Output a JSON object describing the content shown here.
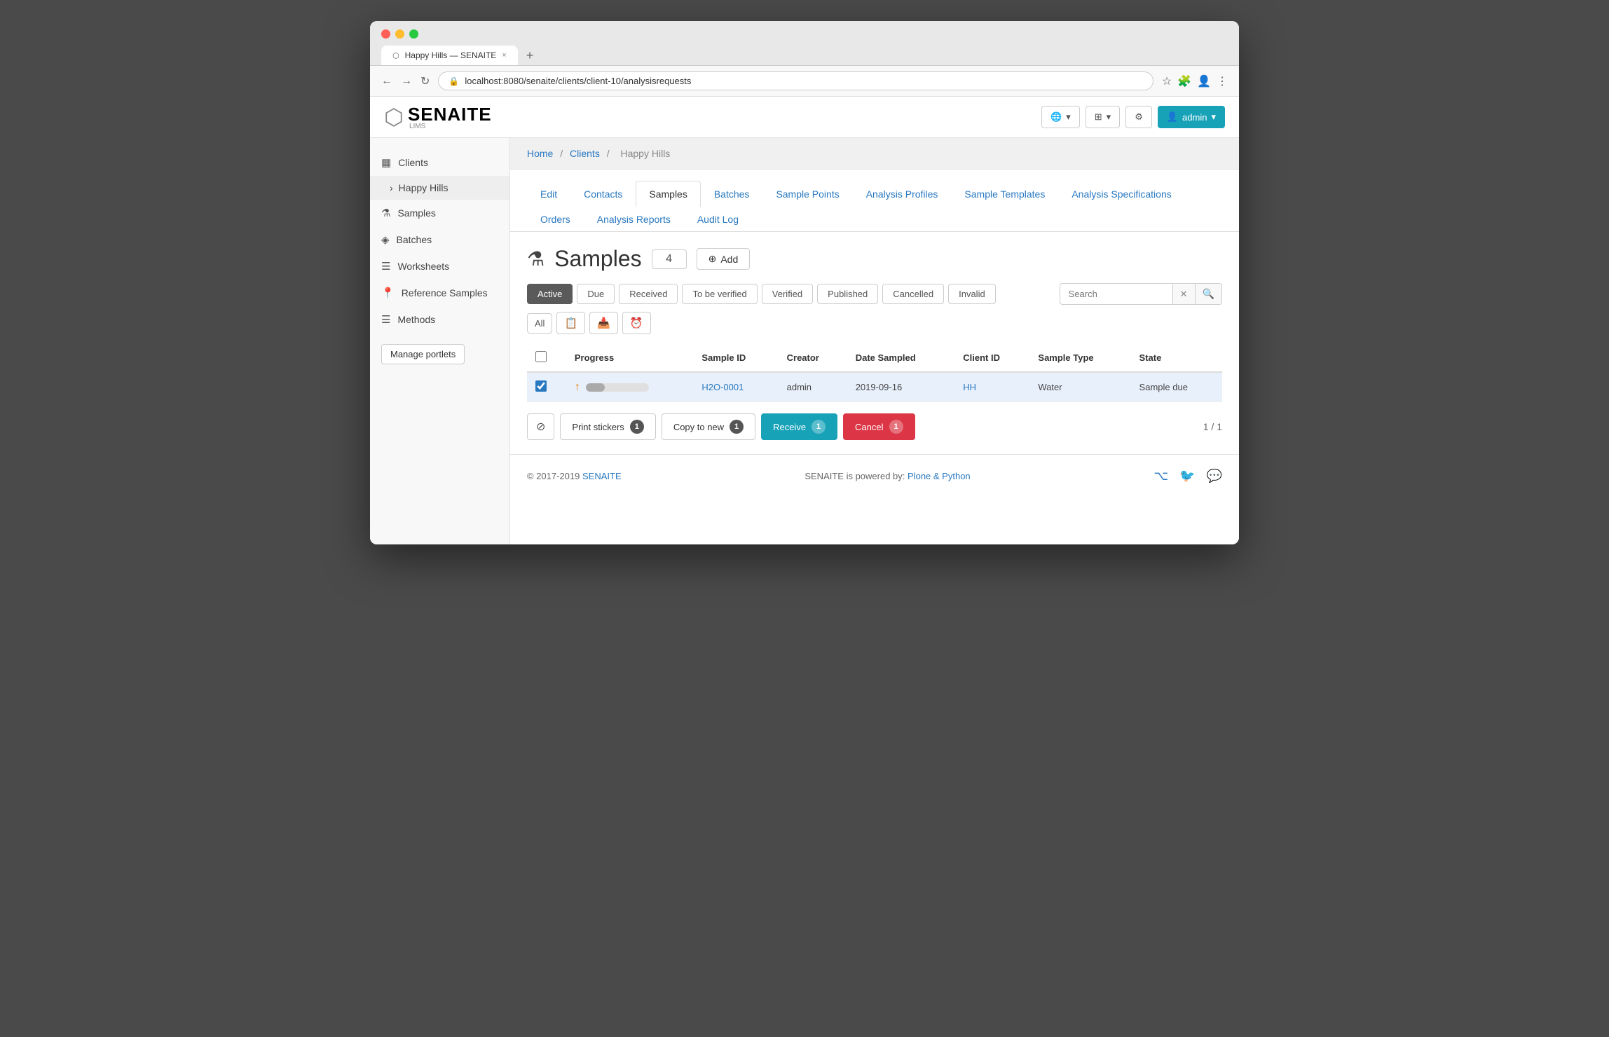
{
  "browser": {
    "tab_title": "Happy Hills — SENAITE",
    "url": "localhost:8080/senaite/clients/client-10/analysisrequests",
    "tab_close": "×",
    "tab_add": "+"
  },
  "topnav": {
    "logo_text": "SENAITE",
    "logo_sub": "LIMS",
    "globe_btn": "🌐",
    "grid_btn": "⊞",
    "gear_btn": "⚙",
    "admin_btn": "admin"
  },
  "sidebar": {
    "items": [
      {
        "id": "clients",
        "icon": "▦",
        "label": "Clients"
      },
      {
        "id": "happy-hills",
        "icon": "›",
        "label": "Happy Hills"
      },
      {
        "id": "samples",
        "icon": "⚗",
        "label": "Samples"
      },
      {
        "id": "batches",
        "icon": "◈",
        "label": "Batches"
      },
      {
        "id": "worksheets",
        "icon": "☰",
        "label": "Worksheets"
      },
      {
        "id": "reference-samples",
        "icon": "📍",
        "label": "Reference Samples"
      },
      {
        "id": "methods",
        "icon": "☰",
        "label": "Methods"
      }
    ],
    "manage_portlets": "Manage portlets"
  },
  "breadcrumb": {
    "home": "Home",
    "clients": "Clients",
    "current": "Happy Hills"
  },
  "tabs": {
    "items": [
      {
        "id": "edit",
        "label": "Edit"
      },
      {
        "id": "contacts",
        "label": "Contacts"
      },
      {
        "id": "samples",
        "label": "Samples",
        "active": true
      },
      {
        "id": "batches",
        "label": "Batches"
      },
      {
        "id": "sample-points",
        "label": "Sample Points"
      },
      {
        "id": "analysis-profiles",
        "label": "Analysis Profiles"
      },
      {
        "id": "sample-templates",
        "label": "Sample Templates"
      },
      {
        "id": "analysis-specifications",
        "label": "Analysis Specifications"
      },
      {
        "id": "orders",
        "label": "Orders"
      },
      {
        "id": "analysis-reports",
        "label": "Analysis Reports"
      },
      {
        "id": "audit-log",
        "label": "Audit Log"
      }
    ]
  },
  "section": {
    "title": "Samples",
    "count": "4",
    "add_label": "Add"
  },
  "filters": {
    "items": [
      {
        "id": "active",
        "label": "Active",
        "active": true
      },
      {
        "id": "due",
        "label": "Due"
      },
      {
        "id": "received",
        "label": "Received"
      },
      {
        "id": "to-be-verified",
        "label": "To be verified"
      },
      {
        "id": "verified",
        "label": "Verified"
      },
      {
        "id": "published",
        "label": "Published"
      },
      {
        "id": "cancelled",
        "label": "Cancelled"
      },
      {
        "id": "invalid",
        "label": "Invalid"
      }
    ],
    "search_placeholder": "Search"
  },
  "table": {
    "columns": [
      {
        "id": "select",
        "label": ""
      },
      {
        "id": "progress",
        "label": "Progress"
      },
      {
        "id": "sample-id",
        "label": "Sample ID"
      },
      {
        "id": "creator",
        "label": "Creator"
      },
      {
        "id": "date-sampled",
        "label": "Date Sampled"
      },
      {
        "id": "client-id",
        "label": "Client ID"
      },
      {
        "id": "sample-type",
        "label": "Sample Type"
      },
      {
        "id": "state",
        "label": "State"
      }
    ],
    "rows": [
      {
        "selected": true,
        "progress": 30,
        "sample_id": "H2O-0001",
        "creator": "admin",
        "date_sampled": "2019-09-16",
        "client_id": "HH",
        "sample_type": "Water",
        "state": "Sample due"
      }
    ]
  },
  "actions": {
    "deselect_icon": "⊘",
    "print_stickers": "Print stickers",
    "print_count": "1",
    "copy_to_new": "Copy to new",
    "copy_count": "1",
    "receive": "Receive",
    "receive_count": "1",
    "cancel": "Cancel",
    "cancel_count": "1",
    "pagination": "1 / 1"
  },
  "footer": {
    "copyright": "© 2017-2019",
    "brand": "SENAITE",
    "powered_by": "SENAITE is powered by:",
    "powered_link": "Plone & Python"
  }
}
